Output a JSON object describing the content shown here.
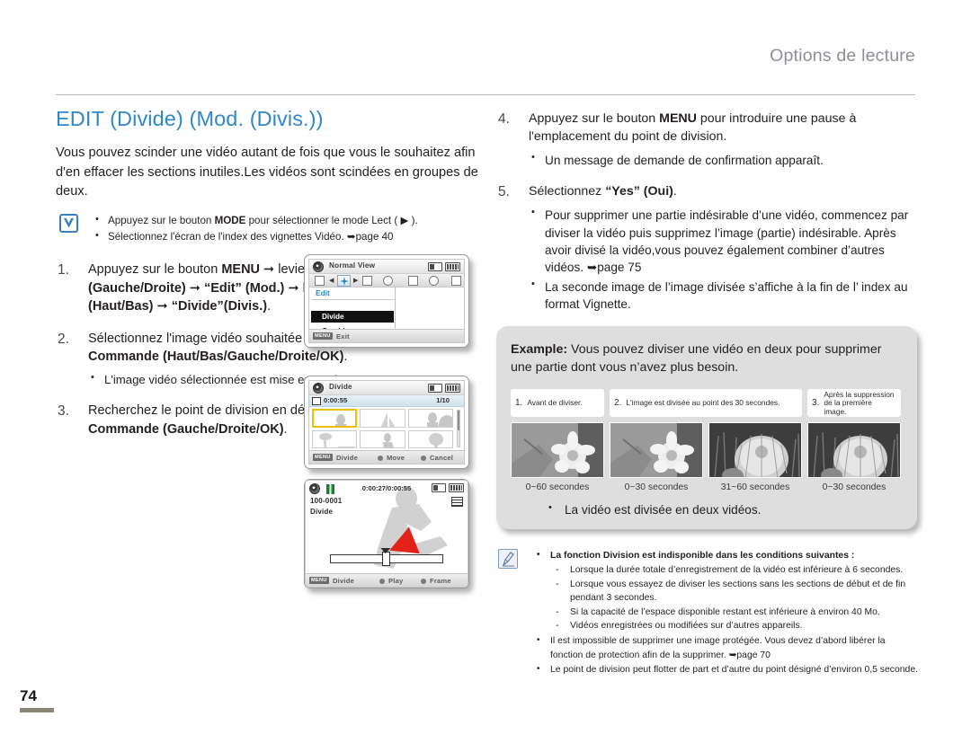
{
  "header": {
    "title": "Options de lecture"
  },
  "page": {
    "number": "74"
  },
  "left": {
    "section_title": "EDIT (Divide) (Mod. (Divis.))",
    "intro": "Vous pouvez scinder une vidéo autant de fois que vous le souhaitez afin d'en effacer les sections inutiles.Les vidéos sont scindées en groupes de deux.",
    "check_note": {
      "icon": "check-v-icon",
      "items": [
        "Appuyez sur le bouton MODE pour sélectionner le mode Lect ( ▶ ).",
        "Sélectionnez l'écran de l'index des vignettes Vidéo. ➥page 40"
      ]
    },
    "steps": [
      {
        "num": "1.",
        "text": "Appuyez sur le bouton MENU ➞ levier de Commande (Gauche/Droite) ➞ “Edit” (Mod.) ➞ levier de Commande (Haut/Bas) ➞ “Divide”(Divis.).",
        "sub": []
      },
      {
        "num": "2.",
        "text": "Sélectionnez l'image vidéo souhaitée à l'aide du levier de Commande (Haut/Bas/Gauche/Droite/OK).",
        "sub": [
          "L'image vidéo sélectionnée est mise en mode pause."
        ]
      },
      {
        "num": "3.",
        "text": "Recherchez le point de division en déplaçant le levier de Commande (Gauche/Droite/OK).",
        "sub": []
      }
    ]
  },
  "right": {
    "steps": [
      {
        "num": "4.",
        "text": "Appuyez sur le bouton MENU pour introduire une pause à l'emplacement du point de division.",
        "sub": [
          "Un message de demande de confirmation apparaît."
        ]
      },
      {
        "num": "5.",
        "text": "Sélectionnez “Yes” (Oui).",
        "sub": [
          "Pour supprimer une partie indésirable d’une vidéo, commencez par diviser la vidéo puis supprimez l’image (partie) indésirable. Après avoir divisé la vidéo,vous pouvez également combiner d’autres vidéos. ➥page 75",
          "La seconde image de l’image divisée s’affiche à la fin de l’ index au format Vignette."
        ]
      }
    ],
    "example": {
      "label": "Example:",
      "text": " Vous pouvez diviser une vidéo en deux pour supprimer une partie dont vous n’avez plus besoin.",
      "columns": [
        {
          "num": "1.",
          "caption": "Avant de diviser."
        },
        {
          "num": "2.",
          "caption": "L'image est divisée au point des 30 secondes."
        },
        {
          "num": "3.",
          "caption": "Après la suppression de la première image."
        }
      ],
      "shots": [
        {
          "sub": "0~60 secondes",
          "kind": "flower"
        },
        {
          "sub": "0~30 secondes",
          "kind": "flower"
        },
        {
          "sub": "31~60 secondes",
          "kind": "cactus"
        },
        {
          "sub": "0~30 secondes",
          "kind": "cactus"
        }
      ],
      "note": "La vidéo est divisée en deux vidéos."
    },
    "caution": {
      "icon": "note-pencil-icon",
      "items": [
        {
          "text": "La fonction Division est indisponible dans les conditions suivantes :",
          "bold": true,
          "sub": [
            "Lorsque la durée totale d’enregistrement de la vidéo est inférieure à 6 secondes.",
            "Lorsque vous essayez de diviser les sections sans les sections de début et de fin pendant 3 secondes.",
            "Si la capacité de l’espace disponible restant est inférieure à environ 40 Mo.",
            "Vidéos enregistrées ou modifiées sur d’autres appareils."
          ]
        },
        {
          "text": "Il est impossible de supprimer une image protégée. Vous devez d’abord libérer la fonction de protection afin de la supprimer. ➥page 70",
          "bold": false,
          "sub": []
        },
        {
          "text": "Le point de division peut flotter de part et d’autre du point désigné d’environ 0,5 seconde.",
          "bold": false,
          "sub": []
        }
      ]
    }
  },
  "screens": {
    "menu": {
      "title": "Normal View",
      "menu_header": "Edit",
      "items": [
        {
          "label": "Divide",
          "selected": true
        },
        {
          "label": "Combine",
          "selected": false
        }
      ],
      "footer_key": "MENU",
      "footer_label": "Exit"
    },
    "index": {
      "title": "Divide",
      "time": "0:00:55",
      "count": "1/10",
      "footer": [
        {
          "key": "MENU",
          "label": "Divide"
        },
        {
          "key": "dot",
          "label": "Move"
        },
        {
          "key": "dot",
          "label": "Cancel"
        }
      ]
    },
    "play": {
      "time": "0:00:27/0:00:55",
      "file": "100-0001",
      "mode": "Divide",
      "footer": [
        {
          "key": "MENU",
          "label": "Divide"
        },
        {
          "key": "dot",
          "label": "Play"
        },
        {
          "key": "dot",
          "label": "Frame"
        }
      ]
    }
  },
  "colors": {
    "accent_blue": "#2f89c8",
    "header_gray": "#8e8e99",
    "panel_gray": "#dedede",
    "select_yellow": "#f0c000",
    "arrow_red": "#e2231a",
    "page_bar": "#8a8777"
  }
}
